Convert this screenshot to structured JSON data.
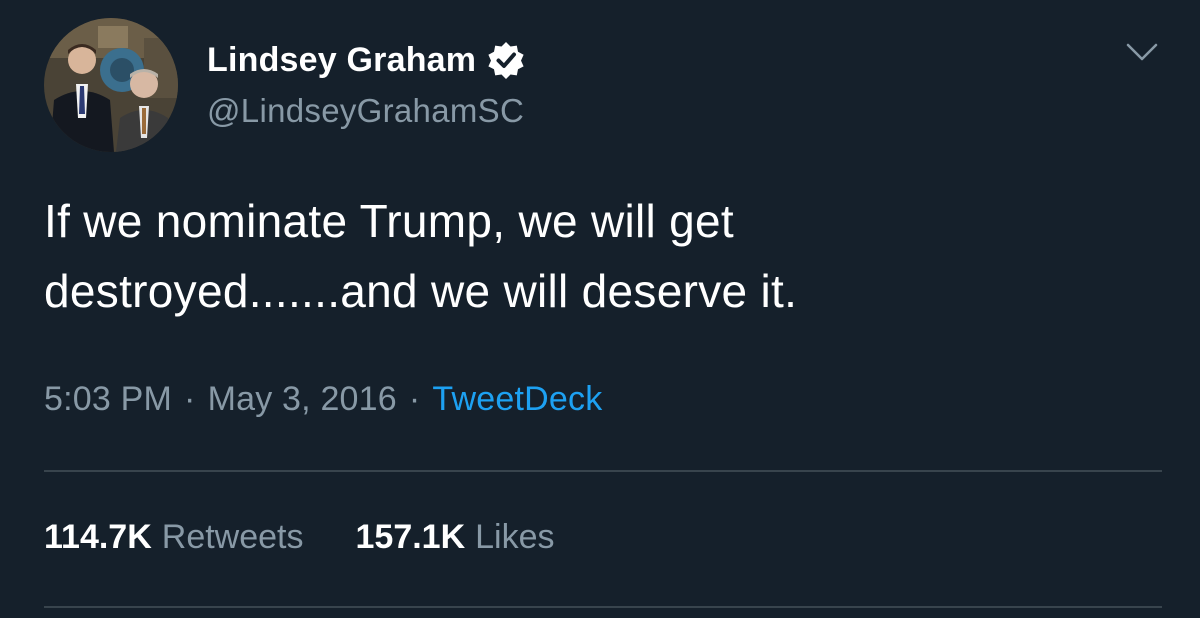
{
  "author": {
    "display_name": "Lindsey Graham",
    "handle": "@LindseyGrahamSC",
    "verified": true,
    "avatar_icon": "profile-photo-two-men-in-suits"
  },
  "tweet": {
    "text_line1": "If we nominate Trump, we will get",
    "text_line2": "destroyed.......and we will deserve it.",
    "time": "5:03 PM",
    "separator": "·",
    "date": "May 3, 2016",
    "source": "TweetDeck"
  },
  "stats": {
    "retweets_count": "114.7K",
    "retweets_label": "Retweets",
    "likes_count": "157.1K",
    "likes_label": "Likes"
  },
  "colors": {
    "background": "#15202b",
    "primary_text": "#ffffff",
    "secondary_text": "#8899a6",
    "link": "#1da1f2",
    "divider": "#38444d"
  },
  "icons": {
    "verified": "verified-badge-icon",
    "menu": "chevron-down-icon"
  }
}
